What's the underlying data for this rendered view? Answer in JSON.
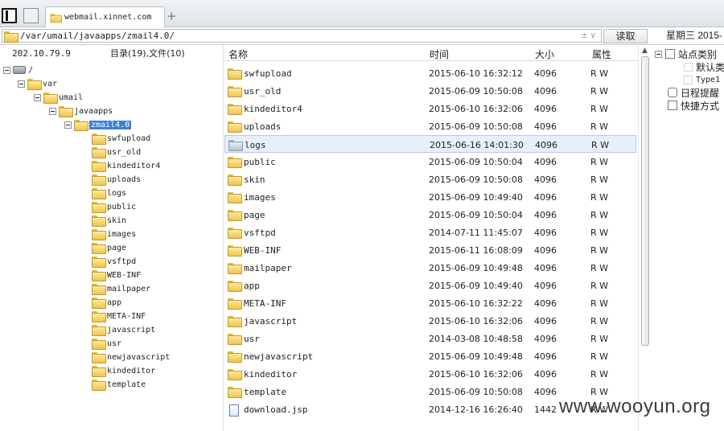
{
  "browser": {
    "tab_title": "webmail.xinnet.com",
    "new_tab": "+"
  },
  "address": {
    "path": "/var/umail/javaapps/zmail4.0/",
    "dropdown_marks": "± ∨",
    "read_button": "读取",
    "weekday": "星期三 2015-"
  },
  "left": {
    "ip": "202.10.79.9",
    "summary": "目录(19),文件(10)"
  },
  "tree": {
    "root": "/",
    "var": "var",
    "umail": "umail",
    "javaapps": "javaapps",
    "zmail": "zmail4.0",
    "children": [
      "swfupload",
      "usr_old",
      "kindeditor4",
      "uploads",
      "logs",
      "public",
      "skin",
      "images",
      "page",
      "vsftpd",
      "WEB-INF",
      "mailpaper",
      "app",
      "META-INF",
      "javascript",
      "usr",
      "newjavascript",
      "kindeditor",
      "template"
    ]
  },
  "table": {
    "headers": {
      "name": "名称",
      "time": "时间",
      "size": "大小",
      "attr": "属性"
    },
    "rows": [
      {
        "name": "swfupload",
        "time": "2015-06-10 16:32:12",
        "size": "4096",
        "attr": "R W"
      },
      {
        "name": "usr_old",
        "time": "2015-06-09 10:50:08",
        "size": "4096",
        "attr": "R W"
      },
      {
        "name": "kindeditor4",
        "time": "2015-06-10 16:32:06",
        "size": "4096",
        "attr": "R W"
      },
      {
        "name": "uploads",
        "time": "2015-06-09 10:50:08",
        "size": "4096",
        "attr": "R W"
      },
      {
        "name": "logs",
        "time": "2015-06-16 14:01:30",
        "size": "4096",
        "attr": "R W"
      },
      {
        "name": "public",
        "time": "2015-06-09 10:50:04",
        "size": "4096",
        "attr": "R W"
      },
      {
        "name": "skin",
        "time": "2015-06-09 10:50:08",
        "size": "4096",
        "attr": "R W"
      },
      {
        "name": "images",
        "time": "2015-06-09 10:49:40",
        "size": "4096",
        "attr": "R W"
      },
      {
        "name": "page",
        "time": "2015-06-09 10:50:04",
        "size": "4096",
        "attr": "R W"
      },
      {
        "name": "vsftpd",
        "time": "2014-07-11 11:45:07",
        "size": "4096",
        "attr": "R W"
      },
      {
        "name": "WEB-INF",
        "time": "2015-06-11 16:08:09",
        "size": "4096",
        "attr": "R W"
      },
      {
        "name": "mailpaper",
        "time": "2015-06-09 10:49:48",
        "size": "4096",
        "attr": "R W"
      },
      {
        "name": "app",
        "time": "2015-06-09 10:49:40",
        "size": "4096",
        "attr": "R W"
      },
      {
        "name": "META-INF",
        "time": "2015-06-10 16:32:22",
        "size": "4096",
        "attr": "R W"
      },
      {
        "name": "javascript",
        "time": "2015-06-10 16:32:06",
        "size": "4096",
        "attr": "R W"
      },
      {
        "name": "usr",
        "time": "2014-03-08 10:48:58",
        "size": "4096",
        "attr": "R W"
      },
      {
        "name": "newjavascript",
        "time": "2015-06-09 10:49:48",
        "size": "4096",
        "attr": "R W"
      },
      {
        "name": "kindeditor",
        "time": "2015-06-10 16:32:06",
        "size": "4096",
        "attr": "R W"
      },
      {
        "name": "template",
        "time": "2015-06-09 10:50:08",
        "size": "4096",
        "attr": "R W"
      },
      {
        "name": "download.jsp",
        "time": "2014-12-16 16:26:40",
        "size": "1442",
        "attr": "R W",
        "file": true
      }
    ]
  },
  "side": {
    "categories": "站点类别",
    "default": "默认类",
    "type1": "Type1",
    "reminder": "日程提醒",
    "shortcuts": "快捷方式"
  },
  "watermark": "www.wooyun.org"
}
